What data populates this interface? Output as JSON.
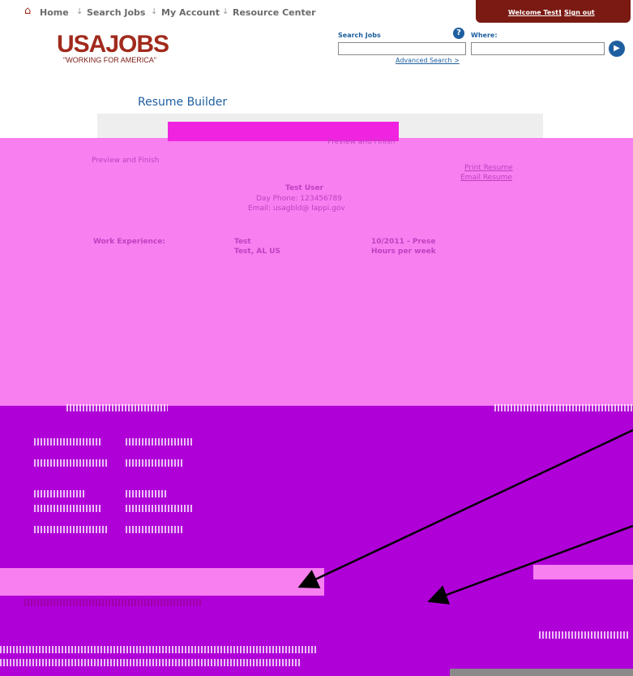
{
  "nav": {
    "home": "Home",
    "search_jobs": "Search Jobs",
    "my_account": "My Account",
    "resource_center": "Resource Center",
    "welcome": "Welcome Test!",
    "sign_out": "Sign out"
  },
  "logo": {
    "name": "USAJOBS",
    "tagline": "\"WORKING FOR AMERICA\""
  },
  "search": {
    "search_jobs_label": "Search Jobs",
    "where_label": "Where:",
    "advanced": "Advanced Search >"
  },
  "resume": {
    "title": "Resume Builder",
    "step": "Preview and Finish",
    "section_heading": "Preview and Finish",
    "print_link": "Print Resume",
    "email_link": "Email Resume",
    "name": "Test User",
    "phone": "Day Phone: 123456789",
    "email": "Email: usagbld@ lappi.gov",
    "work_label": "Work Experience:",
    "employer": "Test",
    "location": "Test, AL US",
    "dates": "10/2011 - Prese",
    "hours": "Hours per week"
  },
  "colors": {
    "brand_red": "#a12a1c",
    "link_blue": "#1e5fa0",
    "magenta": "#f77ff0",
    "purple": "#b000d8"
  }
}
